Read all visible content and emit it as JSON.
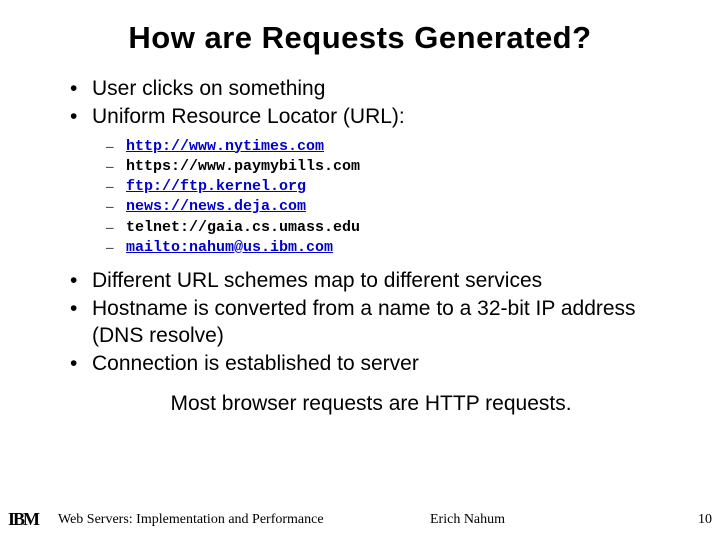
{
  "title": "How are Requests Generated?",
  "bullets_top": [
    "User clicks on something",
    "Uniform Resource Locator (URL):"
  ],
  "urls": [
    {
      "text": "http://www.nytimes.com",
      "link": true
    },
    {
      "text": "https://www.paymybills.com",
      "link": false
    },
    {
      "text": "ftp://ftp.kernel.org",
      "link": true
    },
    {
      "text": "news://news.deja.com",
      "link": true
    },
    {
      "text": "telnet://gaia.cs.umass.edu",
      "link": false
    },
    {
      "text": "mailto:nahum@us.ibm.com",
      "link": true
    }
  ],
  "bullets_bottom": [
    "Different URL schemes map to different services",
    "Hostname is converted from a name to a 32-bit IP address (DNS resolve)",
    "Connection is established to server"
  ],
  "callout": "Most browser requests are HTTP requests.",
  "footer": {
    "logo": "IBM",
    "left": "Web Servers: Implementation and Performance",
    "author": "Erich Nahum",
    "page": "10"
  }
}
